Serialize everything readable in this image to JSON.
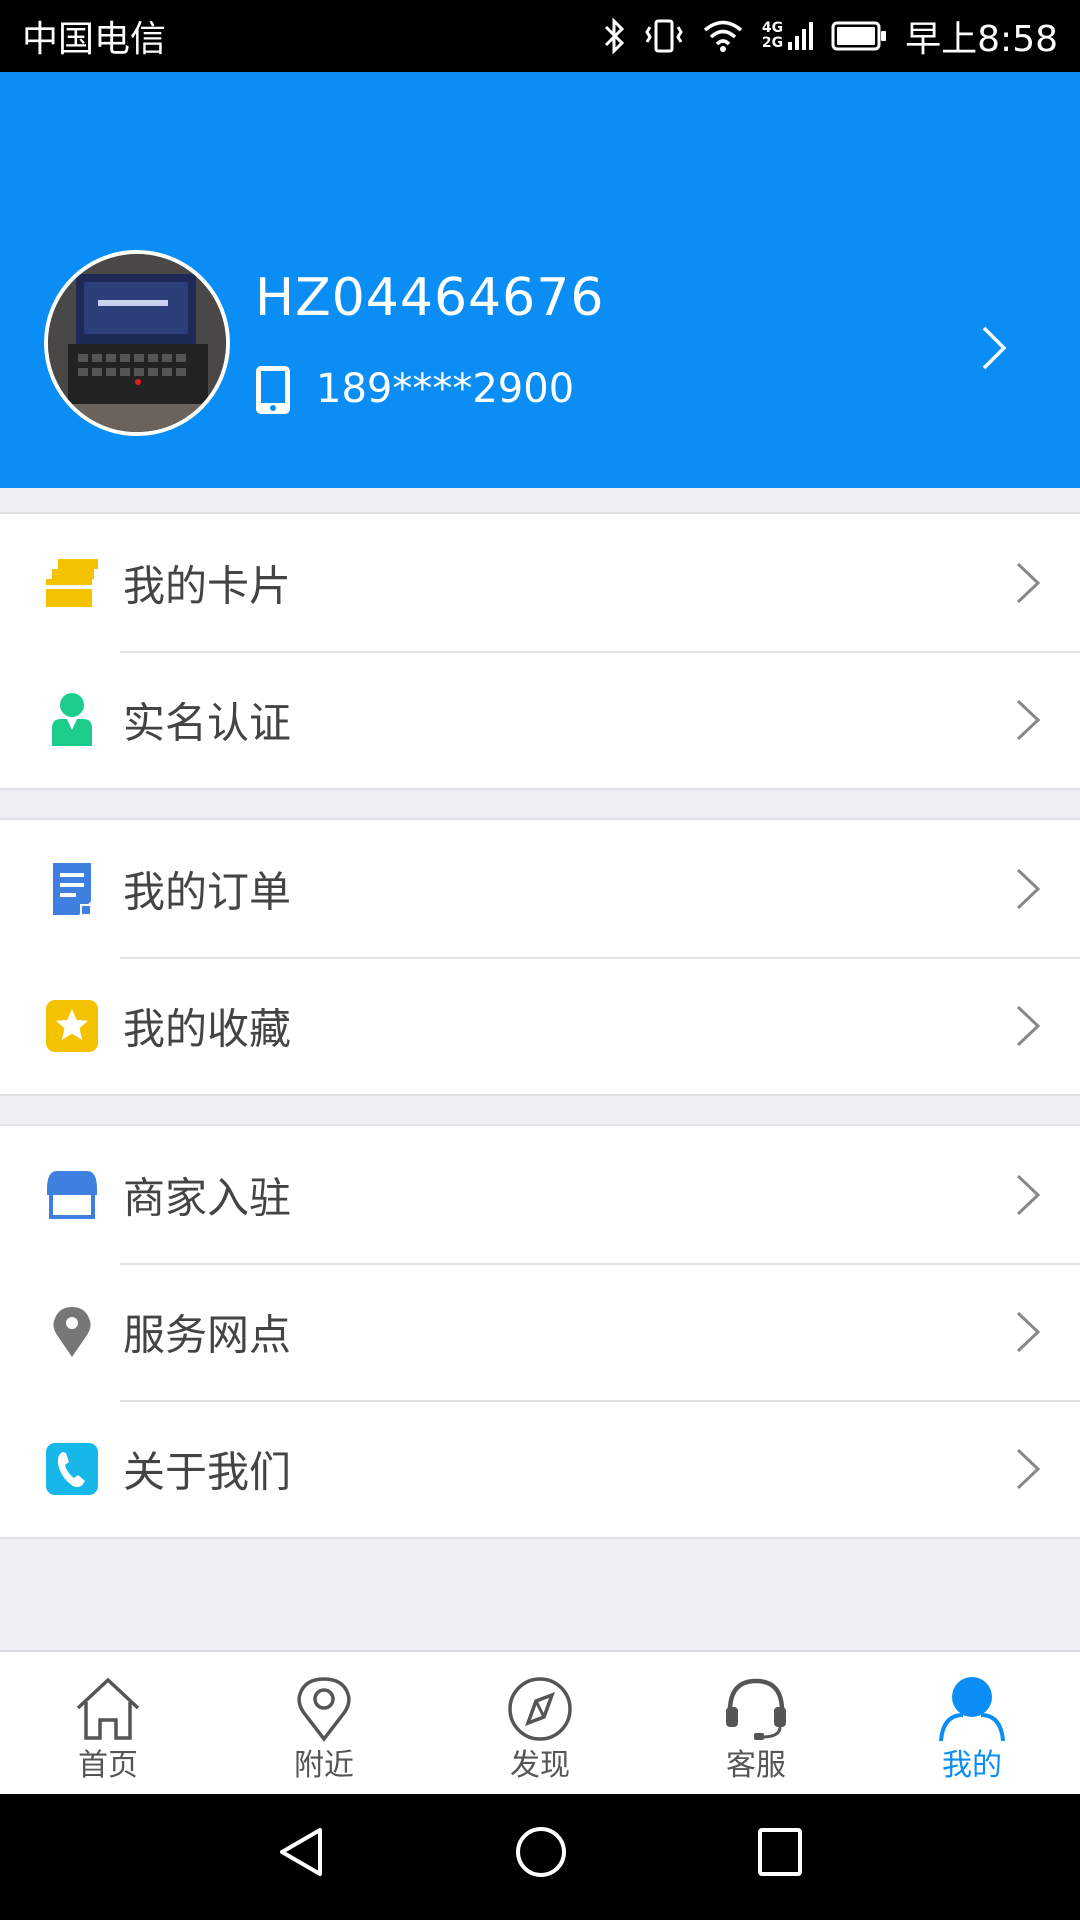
{
  "status_bar": {
    "carrier": "中国电信",
    "time": "早上8:58",
    "icons": [
      "bluetooth-icon",
      "vibrate-icon",
      "wifi-icon",
      "signal-4g-2g-icon",
      "battery-icon"
    ],
    "network_label_top": "4G",
    "network_label_bottom": "2G"
  },
  "profile": {
    "username": "HZ04464676",
    "phone": "189****2900",
    "background_color": "#0a8ef5"
  },
  "menu_groups": [
    {
      "items": [
        {
          "label": "我的卡片",
          "icon": "card-icon",
          "icon_color": "#f5c200"
        },
        {
          "label": "实名认证",
          "icon": "user-verify-icon",
          "icon_color": "#1ccc8a"
        }
      ]
    },
    {
      "items": [
        {
          "label": "我的订单",
          "icon": "order-icon",
          "icon_color": "#3f7fe0"
        },
        {
          "label": "我的收藏",
          "icon": "favorite-star-icon",
          "icon_color": "#f5c200"
        }
      ]
    },
    {
      "items": [
        {
          "label": "商家入驻",
          "icon": "store-icon",
          "icon_color": "#3f7fe0"
        },
        {
          "label": "服务网点",
          "icon": "location-pin-icon",
          "icon_color": "#777777"
        },
        {
          "label": "关于我们",
          "icon": "phone-call-icon",
          "icon_color": "#17b7ea"
        }
      ]
    }
  ],
  "bottom_nav": {
    "items": [
      {
        "label": "首页",
        "icon": "home-icon",
        "active": false
      },
      {
        "label": "附近",
        "icon": "nearby-pin-icon",
        "active": false
      },
      {
        "label": "发现",
        "icon": "compass-icon",
        "active": false
      },
      {
        "label": "客服",
        "icon": "headset-icon",
        "active": false
      },
      {
        "label": "我的",
        "icon": "profile-icon",
        "active": true
      }
    ],
    "active_color": "#0a8ef5"
  },
  "system_nav": {
    "buttons": [
      "back-icon",
      "home-circle-icon",
      "recents-icon"
    ]
  }
}
